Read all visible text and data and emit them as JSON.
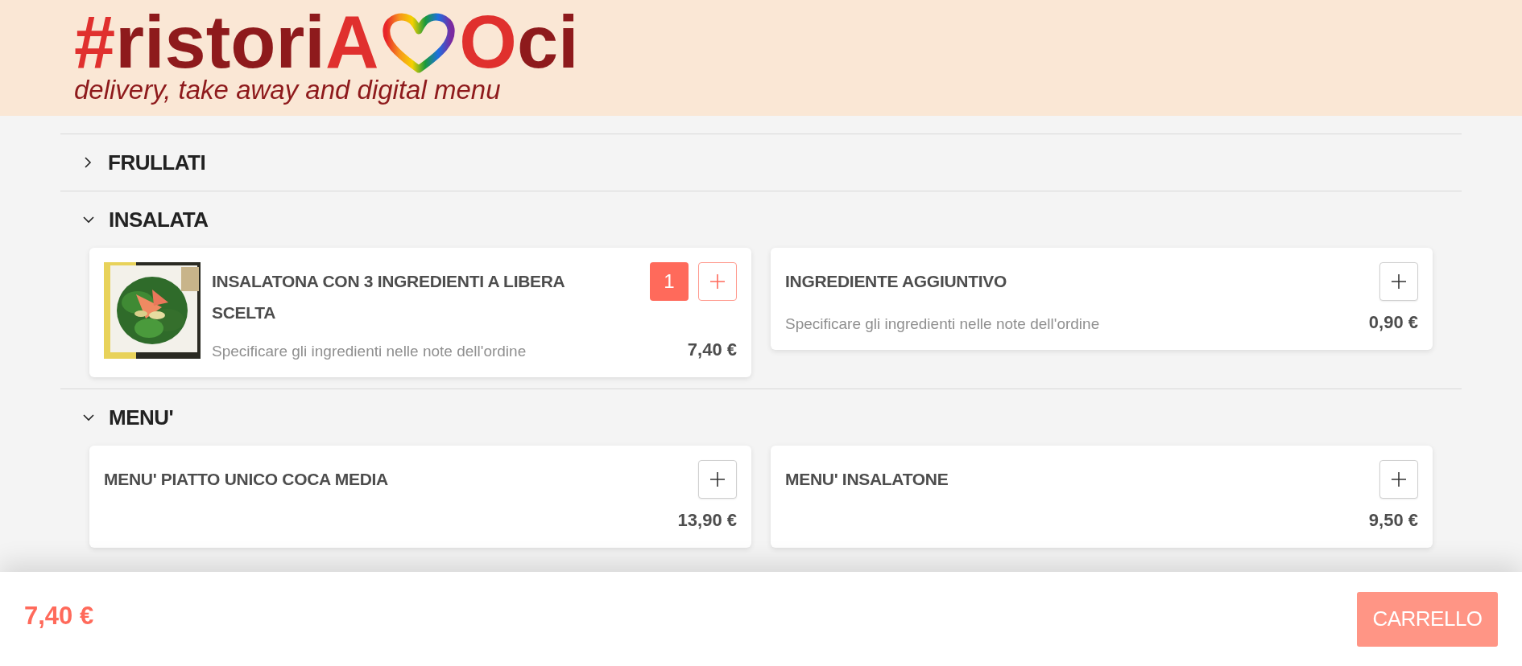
{
  "logo": {
    "segments": [
      {
        "text": "#",
        "color": "#e0302e"
      },
      {
        "text": "ristori",
        "color": "#8e1a1c"
      },
      {
        "text": "A",
        "color": "#e0302e"
      },
      {
        "text": "O",
        "color": "#e0302e"
      },
      {
        "text": "ci",
        "color": "#8e1a1c"
      }
    ],
    "tagline": "delivery, take away and digital menu"
  },
  "sections": [
    {
      "title": "FRULLATI",
      "expanded": false
    },
    {
      "title": "INSALATA",
      "expanded": true,
      "items": [
        {
          "name": "INSALATONA CON 3 INGREDIENTI A LIBERA SCELTA",
          "description": "Specificare gli ingredienti nelle note dell'ordine",
          "price": "7,40 €",
          "quantity": "1"
        },
        {
          "name": "INGREDIENTE AGGIUNTIVO",
          "description": "Specificare gli ingredienti nelle note dell'ordine",
          "price": "0,90 €"
        }
      ]
    },
    {
      "title": "MENU'",
      "expanded": true,
      "items": [
        {
          "name": "MENU' PIATTO UNICO COCA MEDIA",
          "price": "13,90 €"
        },
        {
          "name": "MENU' INSALATONE",
          "price": "9,50 €"
        }
      ]
    }
  ],
  "cart": {
    "total": "7,40 €",
    "button": "CARRELLO"
  }
}
